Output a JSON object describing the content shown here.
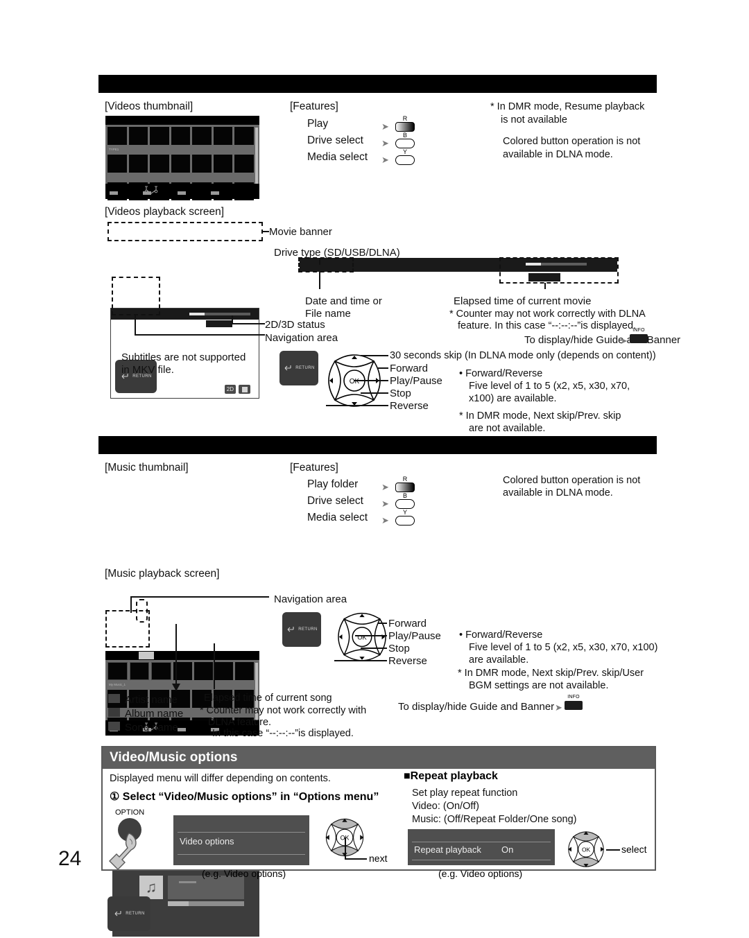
{
  "page": {
    "number": "24"
  },
  "section_videos": {
    "thumbnail_label": "[Videos thumbnail]",
    "playback_label": "[Videos playback screen]",
    "thumb_file_label": "TYPE1",
    "features_title": "[Features]",
    "features": [
      {
        "label": "Play",
        "button": "R"
      },
      {
        "label": "Drive select",
        "button": "B"
      },
      {
        "label": "Media select",
        "button": "Y"
      }
    ],
    "notes": [
      "* In DMR mode, Resume playback",
      "  is not available",
      "Colored button operation is not",
      "available in DLNA mode."
    ],
    "note_dmr_1": "* In DMR mode, Resume playback",
    "note_dmr_2": "is not available",
    "note_colored_1": "Colored button operation is not",
    "note_colored_2": "available in DLNA mode.",
    "callouts": {
      "movie_banner": "Movie banner",
      "drive_type": "Drive type (SD/USB/DLNA)",
      "date_time_1": "Date and time or",
      "date_time_2": "File name",
      "status_2d3d": "2D/3D status",
      "navigation_area": "Navigation area",
      "elapsed": "Elapsed time of current movie",
      "counter_1": "* Counter may not work correctly with DLNA",
      "counter_2": "feature. In this case “--:--:--”is displayed.",
      "guide_banner": "To display/hide Guide and Banner",
      "info_button": "INFO"
    },
    "subtitles_note_1": "Subtitles are not supported",
    "subtitles_note_2": "in MKV file.",
    "dpad": {
      "skip": "30 seconds skip (In DLNA mode only (depends on content))",
      "forward": "Forward",
      "play_pause": "Play/Pause",
      "stop": "Stop",
      "reverse": "Reverse",
      "ok": "OK"
    },
    "bullets": {
      "fwd_rev": "• Forward/Reverse",
      "levels_1": "Five level of 1 to 5 (x2, x5, x30, x70,",
      "levels_2": "x100) are available.",
      "dmr_1": "* In DMR mode, Next skip/Prev. skip",
      "dmr_2": "are not available."
    },
    "return_label": "RETURN",
    "badge_2d": "2D"
  },
  "section_music": {
    "thumbnail_label": "[Music thumbnail]",
    "playback_label": "[Music playback screen]",
    "thumb_file_label": "My Music_1",
    "features_title": "[Features]",
    "features": [
      {
        "label": "Play folder",
        "button": "R"
      },
      {
        "label": "Drive select",
        "button": "B"
      },
      {
        "label": "Media select",
        "button": "Y"
      }
    ],
    "note_colored_1": "Colored button operation is not",
    "note_colored_2": "available in DLNA mode.",
    "callouts": {
      "navigation_area": "Navigation area",
      "elapsed": "Elapsed time of current song",
      "counter_1": "* Counter may not work correctly with",
      "counter_2": "DLNA feature.",
      "counter_3": "In this case “--:--:--”is displayed.",
      "guide_banner": "To display/hide Guide and Banner",
      "info_button": "INFO"
    },
    "legend": [
      {
        "label": "Artist name"
      },
      {
        "label": "Album name"
      },
      {
        "label": "Song name"
      }
    ],
    "dpad": {
      "forward": "Forward",
      "play_pause": "Play/Pause",
      "stop": "Stop",
      "reverse": "Reverse",
      "ok": "OK"
    },
    "bullets": {
      "fwd_rev": "• Forward/Reverse",
      "levels_1": "Five level of 1 to 5 (x2, x5, x30, x70, x100)",
      "levels_2": "are available.",
      "dmr_1": "* In DMR mode, Next skip/Prev. skip/User",
      "dmr_2": "BGM settings are not available."
    },
    "return_label": "RETURN"
  },
  "options": {
    "title": "Video/Music options",
    "intro": "Displayed menu will differ depending on contents.",
    "step1": "① Select “Video/Music options” in “Options menu”",
    "option_button_label": "OPTION",
    "menu1_item": "Video options",
    "menu1_caption": "(e.g. Video options)",
    "next_label": "next",
    "repeat_heading": "■Repeat playback",
    "repeat_line1": "Set play repeat function",
    "repeat_line2": "Video: (On/Off)",
    "repeat_line3": "Music: (Off/Repeat Folder/One song)",
    "menu2_item": "Repeat playback",
    "menu2_value": "On",
    "menu2_caption": "(e.g. Video options)",
    "select_label": "select",
    "ok": "OK"
  },
  "colors": {
    "header_bar": "#000000",
    "panel_header": "#5f5f5f",
    "menu_bg": "#4f4f4f",
    "screen_gray": "#6a6a6a"
  }
}
